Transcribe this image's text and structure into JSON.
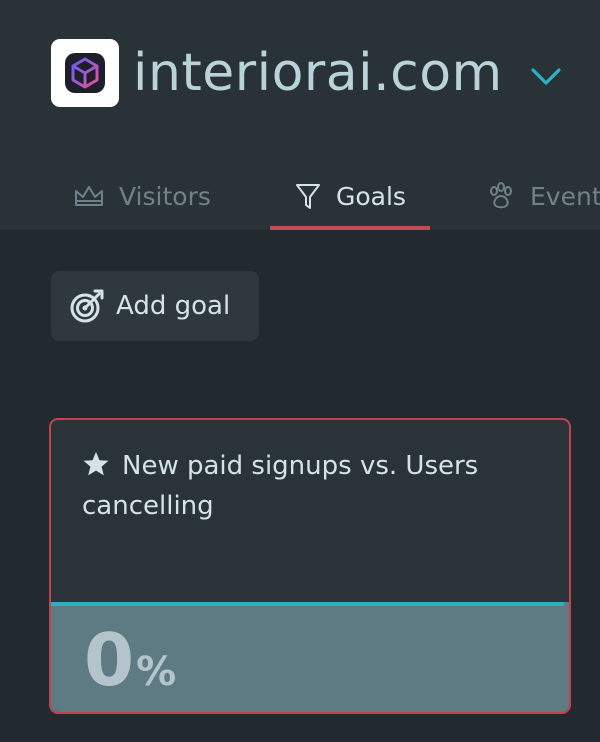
{
  "site": {
    "name": "interiorai.com"
  },
  "tabs": [
    {
      "label": "Visitors",
      "icon": "crown-icon",
      "active": false
    },
    {
      "label": "Goals",
      "icon": "funnel-icon",
      "active": true
    },
    {
      "label": "Events",
      "icon": "paw-icon",
      "active": false
    }
  ],
  "add_goal": {
    "label": "Add goal",
    "icon": "target-icon"
  },
  "goal_card": {
    "title": "New paid signups vs. Users cancelling",
    "percent_value": "0",
    "percent_symbol": "%",
    "progress_fraction": 0.99
  },
  "colors": {
    "accent": "#c24b57",
    "progress": "#2ab0bf",
    "site_name": "#b9d3d8"
  }
}
